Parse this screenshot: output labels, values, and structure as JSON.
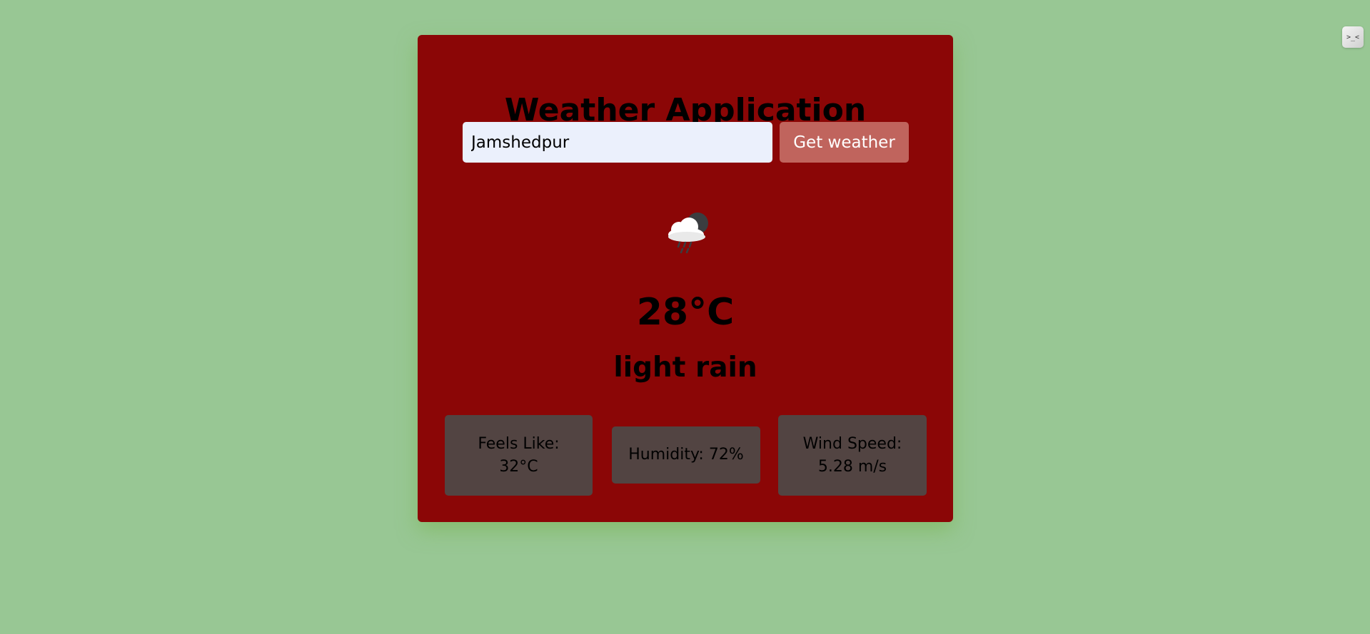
{
  "app": {
    "title": "Weather Application"
  },
  "search": {
    "value": "Jamshedpur",
    "button_label": "Get weather"
  },
  "weather": {
    "icon": "cloud-rain-moon-icon",
    "temperature": "28°C",
    "description": "light rain"
  },
  "details": {
    "feels_like_label": "Feels Like:",
    "feels_like_value": "32°C",
    "humidity": "Humidity: 72%",
    "wind_speed_label": "Wind Speed:",
    "wind_speed_value": "5.28 m/s"
  },
  "extension": {
    "icon": "extension-icon",
    "label": ">_<"
  },
  "colors": {
    "page_background": "#98c794",
    "card_background": "#8b0606",
    "button_background": "#c0645d",
    "detail_box_background": "#524442",
    "input_background": "#ebf0fc"
  }
}
